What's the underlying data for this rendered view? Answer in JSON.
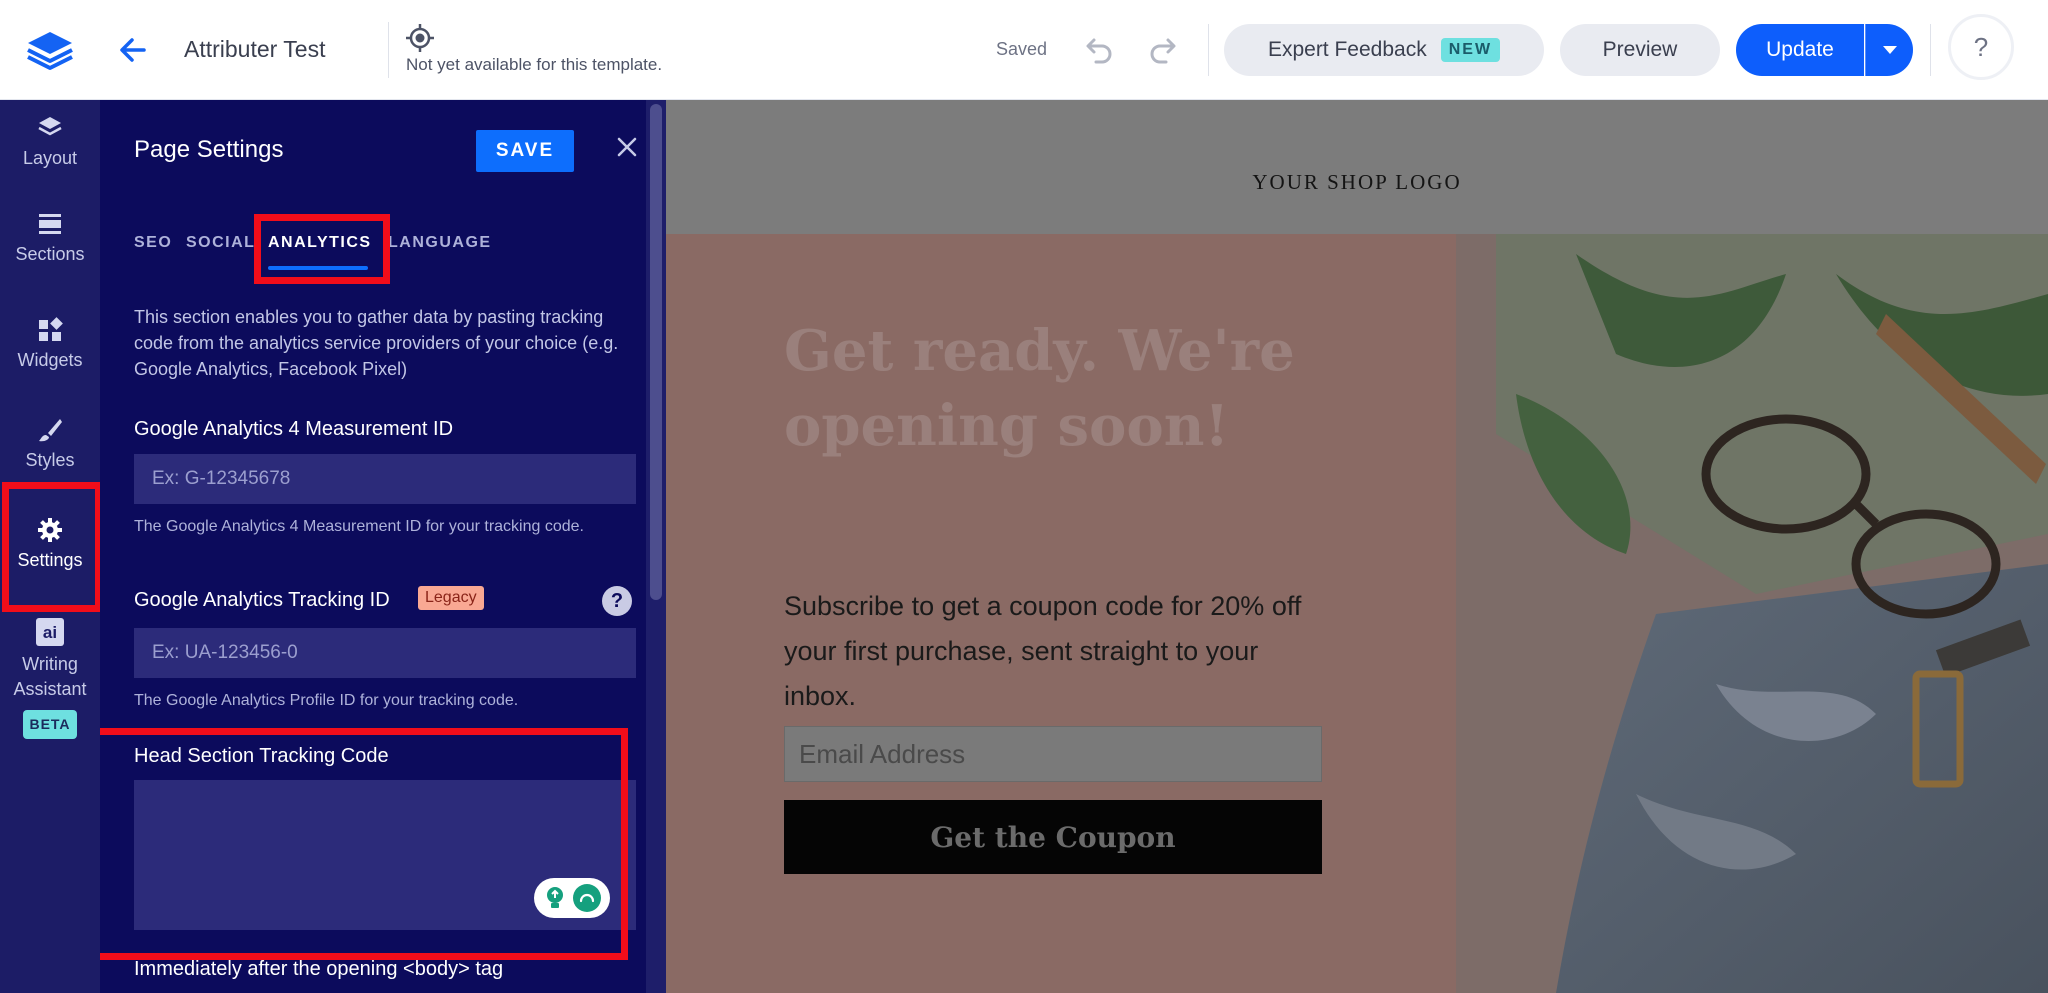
{
  "topbar": {
    "title": "Attributer Test",
    "preview_note": "Not yet available for this template.",
    "saved_label": "Saved",
    "expert_feedback_label": "Expert Feedback",
    "new_badge": "NEW",
    "preview_label": "Preview",
    "update_label": "Update",
    "help_label": "?"
  },
  "rail": {
    "items": [
      {
        "label": "Layout",
        "icon": "layers-icon"
      },
      {
        "label": "Sections",
        "icon": "sections-icon"
      },
      {
        "label": "Widgets",
        "icon": "widgets-icon"
      },
      {
        "label": "Styles",
        "icon": "brush-icon"
      },
      {
        "label": "Settings",
        "icon": "gear-icon"
      },
      {
        "label": "Writing",
        "label2": "Assistant",
        "badge": "BETA",
        "icon": "ai-icon",
        "icon_text": "ai"
      }
    ]
  },
  "panel": {
    "title": "Page Settings",
    "save_label": "SAVE",
    "tabs": [
      "SEO",
      "SOCIAL",
      "ANALYTICS",
      "LANGUAGE"
    ],
    "active_tab": "ANALYTICS",
    "description": "This section enables you to gather data by pasting tracking code from the analytics service providers of your choice (e.g. Google Analytics, Facebook Pixel)",
    "ga4": {
      "label": "Google Analytics 4 Measurement ID",
      "placeholder": "Ex: G-12345678",
      "help": "The Google Analytics 4 Measurement ID for your tracking code."
    },
    "ga_legacy": {
      "label": "Google Analytics Tracking ID",
      "badge": "Legacy",
      "placeholder": "Ex: UA-123456-0",
      "help": "The Google Analytics Profile ID for your tracking code."
    },
    "head_code": {
      "label": "Head Section Tracking Code",
      "value": ""
    },
    "body_code": {
      "label": "Immediately after the opening <body> tag"
    }
  },
  "canvas": {
    "logo_text": "YOUR SHOP LOGO",
    "headline": "Get ready. We're opening soon!",
    "subtext": "Subscribe to get a coupon code for 20% off your first purchase, sent straight to your inbox.",
    "email_placeholder": "Email Address",
    "cta_label": "Get the Coupon"
  },
  "colors": {
    "accent": "#0d5efc",
    "rail_bg": "#1c1c66",
    "panel_bg": "#0c0b5c",
    "highlight": "#f20d1a",
    "badge_cyan": "#6ee0e0"
  }
}
